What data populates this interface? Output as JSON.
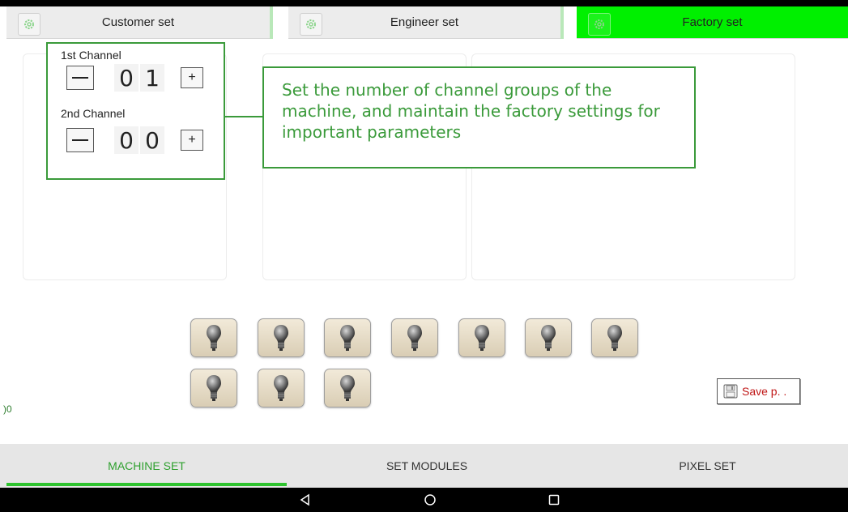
{
  "top_tabs": [
    {
      "label": "Customer set",
      "icon": "gear-icon",
      "active": false
    },
    {
      "label": "Engineer set",
      "icon": "gear-icon",
      "active": false
    },
    {
      "label": "Factory set",
      "icon": "gear-icon",
      "active": true
    }
  ],
  "channels": {
    "first": {
      "label": "1st Channel",
      "digits": [
        "0",
        "1"
      ],
      "minus": "—",
      "plus": "+"
    },
    "second": {
      "label": "2nd Channel",
      "digits": [
        "0",
        "0"
      ],
      "minus": "—",
      "plus": "+"
    }
  },
  "callout": {
    "text": "Set the number of channel groups of the machine, and maintain the factory settings for important parameters"
  },
  "bulbs": {
    "count": 10,
    "icon": "light-bulb-icon"
  },
  "side_text": ")0",
  "save_button": {
    "label": "Save p. .",
    "icon": "floppy-disk-icon"
  },
  "bottom_tabs": [
    {
      "label": "MACHINE SET",
      "active": true
    },
    {
      "label": "SET MODULES",
      "active": false
    },
    {
      "label": "PIXEL SET",
      "active": false
    }
  ],
  "nav": {
    "back_icon": "back-triangle-icon",
    "home_icon": "home-circle-icon",
    "recents_icon": "recents-square-icon"
  },
  "colors": {
    "accent": "#00f000",
    "callout": "#3a9a3a",
    "save_text": "#c01717"
  }
}
